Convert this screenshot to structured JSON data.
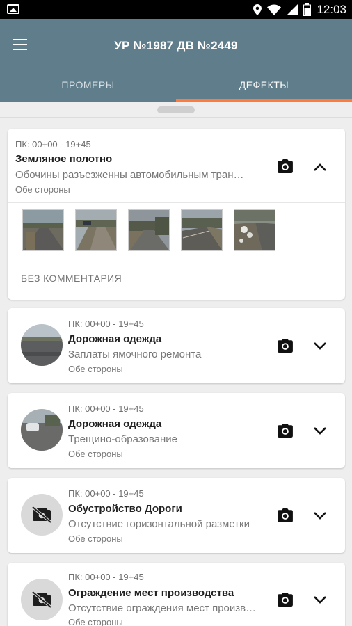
{
  "statusbar": {
    "time": "12:03"
  },
  "header": {
    "title": "УР №1987 ДВ №2449"
  },
  "tabs": [
    {
      "label": "ПРОМЕРЫ"
    },
    {
      "label": "ДЕФЕКТЫ"
    }
  ],
  "defects": [
    {
      "pk": "ПК: 00+00 - 19+45",
      "category": "Земляное полотно",
      "description": "Обочины разъезженны автомобильным транспортом",
      "side": "Обе стороны",
      "expanded": true,
      "photos": 5,
      "comment": "БЕЗ КОММЕНТАРИЯ"
    },
    {
      "pk": "ПК: 00+00 - 19+45",
      "category": "Дорожная одежда",
      "description": "Заплаты ямочного ремонта",
      "side": "Обе стороны"
    },
    {
      "pk": "ПК: 00+00 - 19+45",
      "category": "Дорожная одежда",
      "description": "Трещино-образование",
      "side": "Обе стороны"
    },
    {
      "pk": "ПК: 00+00 - 19+45",
      "category": "Обустройство Дороги",
      "description": "Отсутствие горизонтальной разметки",
      "side": "Обе стороны"
    },
    {
      "pk": "ПК: 00+00 - 19+45",
      "category": "Ограждение мест производства",
      "description": "Отсутствие ограждения мест производства работ",
      "side": "Обе стороны"
    }
  ],
  "icons": {
    "menu": "menu-icon",
    "camera": "camera-icon",
    "chevron_up": "chevron-up-icon",
    "chevron_down": "chevron-down-icon",
    "no_photo": "no-photo-icon"
  },
  "colors": {
    "appbar": "#607d8b",
    "tab_indicator": "#ff7a3d",
    "background": "#eeeeee"
  }
}
